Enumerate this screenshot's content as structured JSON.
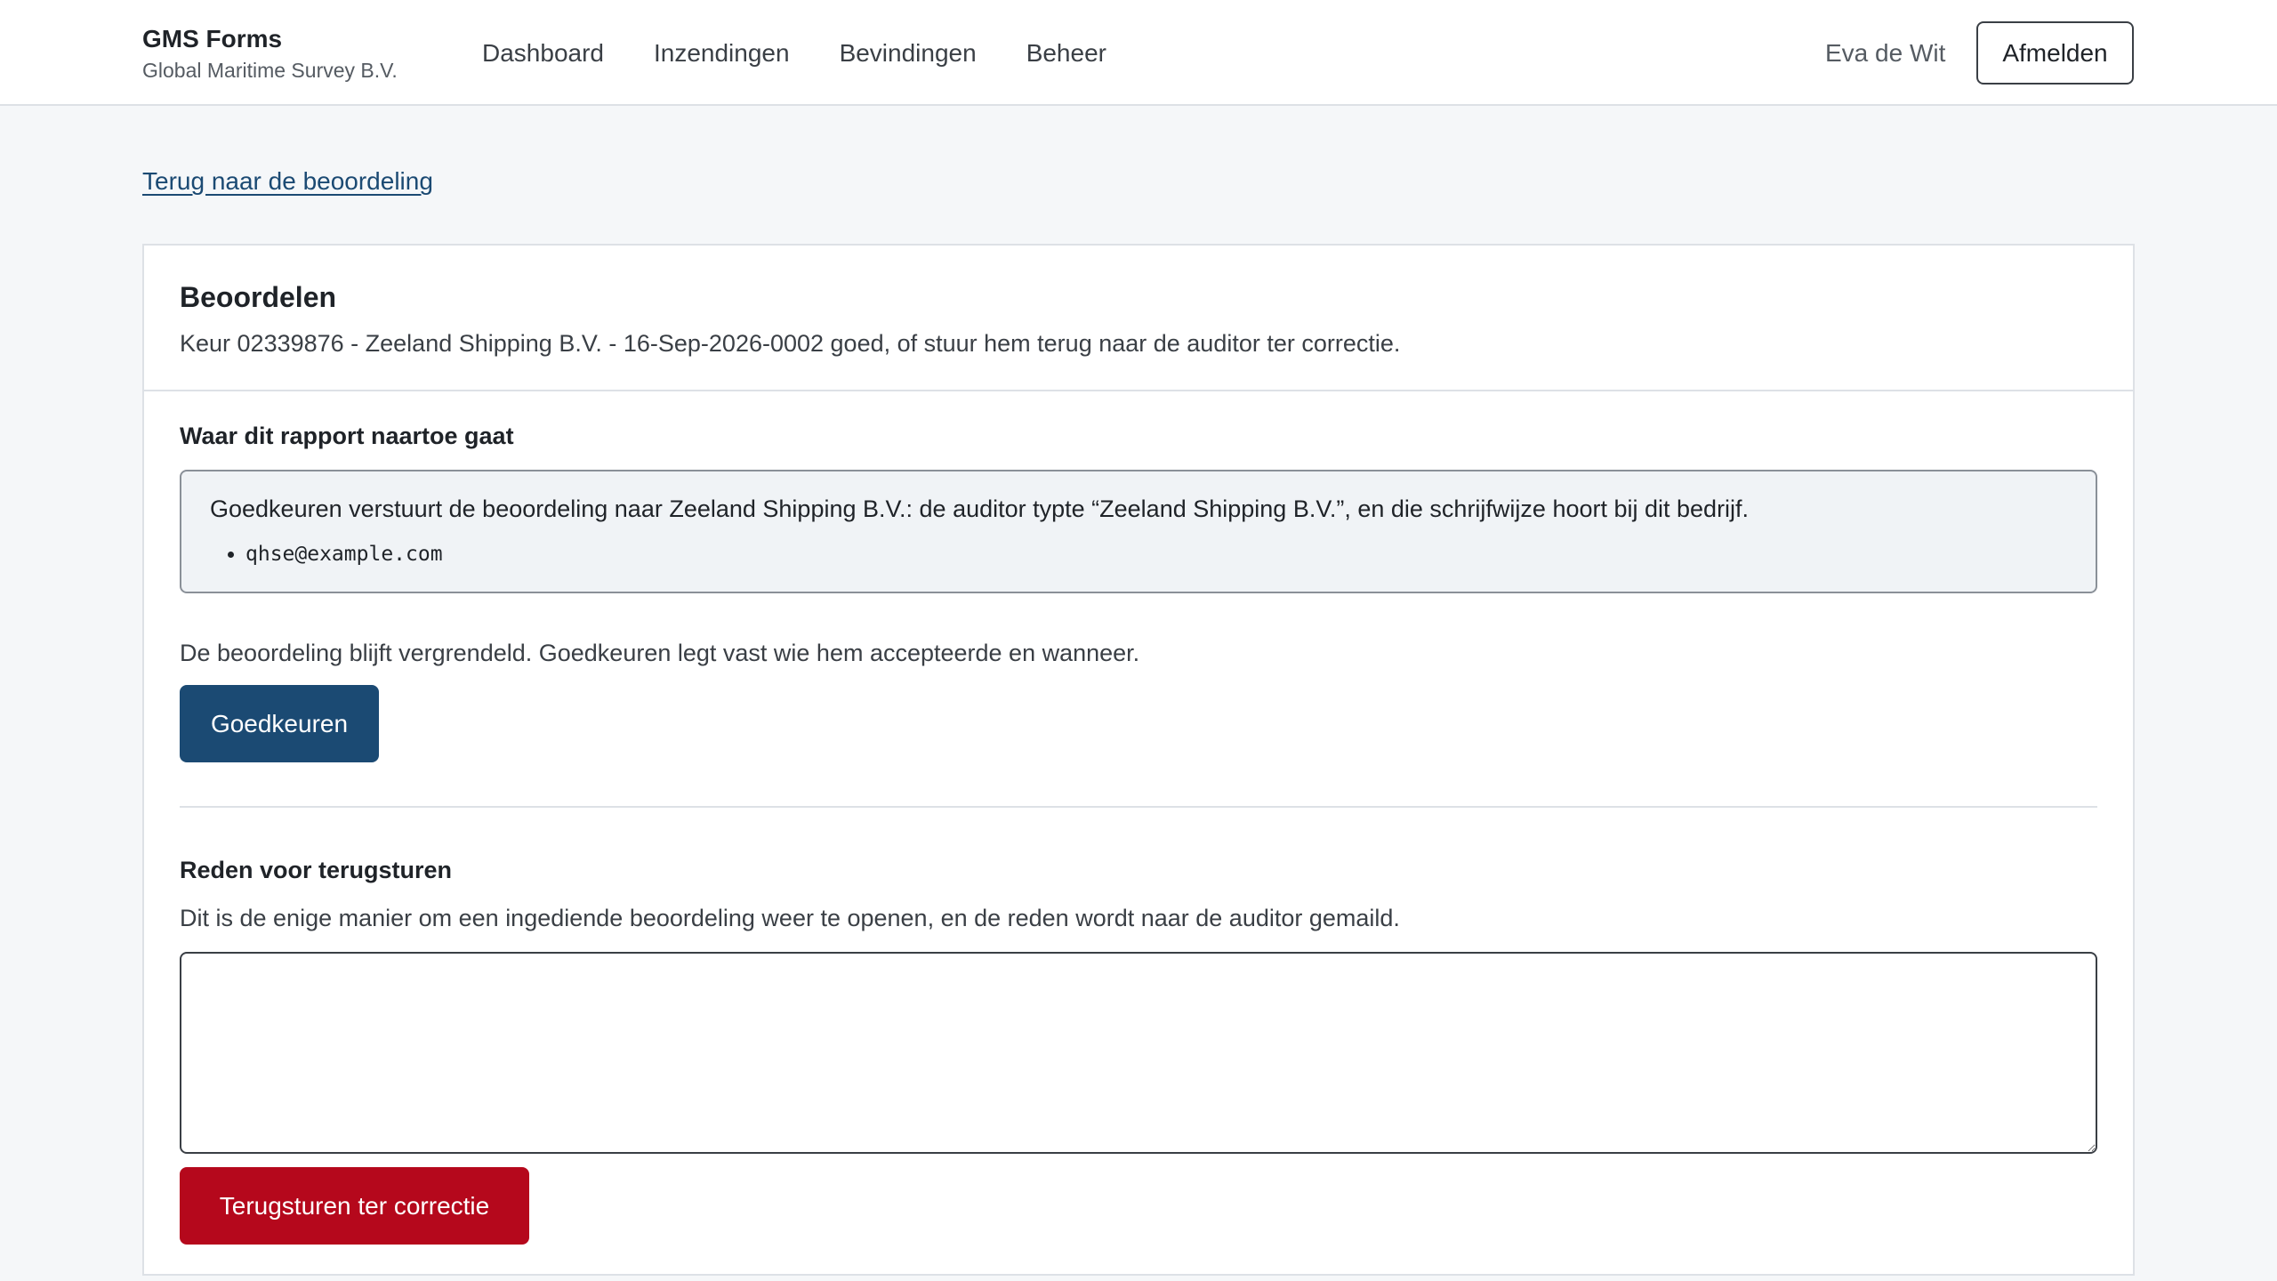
{
  "header": {
    "app_name": "GMS Forms",
    "org_name": "Global Maritime Survey B.V.",
    "nav": [
      {
        "label": "Dashboard"
      },
      {
        "label": "Inzendingen"
      },
      {
        "label": "Bevindingen"
      },
      {
        "label": "Beheer"
      }
    ],
    "user_name": "Eva de Wit",
    "logout_label": "Afmelden"
  },
  "back_link": "Terug naar de beoordeling",
  "card": {
    "title": "Beoordelen",
    "description": "Keur 02339876 - Zeeland Shipping B.V. - 16-Sep-2026-0002 goed, of stuur hem terug naar de auditor ter correctie."
  },
  "destination": {
    "title": "Waar dit rapport naartoe gaat",
    "text": "Goedkeuren verstuurt de beoordeling naar Zeeland Shipping B.V.: de auditor typte “Zeeland Shipping B.V.”, en die schrijfwijze hoort bij dit bedrijf.",
    "recipients": [
      "qhse@example.com"
    ]
  },
  "approve": {
    "note": "De beoordeling blijft vergrendeld. Goedkeuren legt vast wie hem accepteerde en wanneer.",
    "button_label": "Goedkeuren"
  },
  "return": {
    "title": "Reden voor terugsturen",
    "hint": "Dit is de enige manier om een ingediende beoordeling weer te openen, en de reden wordt naar de auditor gemaild.",
    "reason_value": "",
    "button_label": "Terugsturen ter correctie"
  },
  "colors": {
    "primary": "#1b4a73",
    "danger": "#b5081c",
    "background": "#f5f7f9"
  }
}
